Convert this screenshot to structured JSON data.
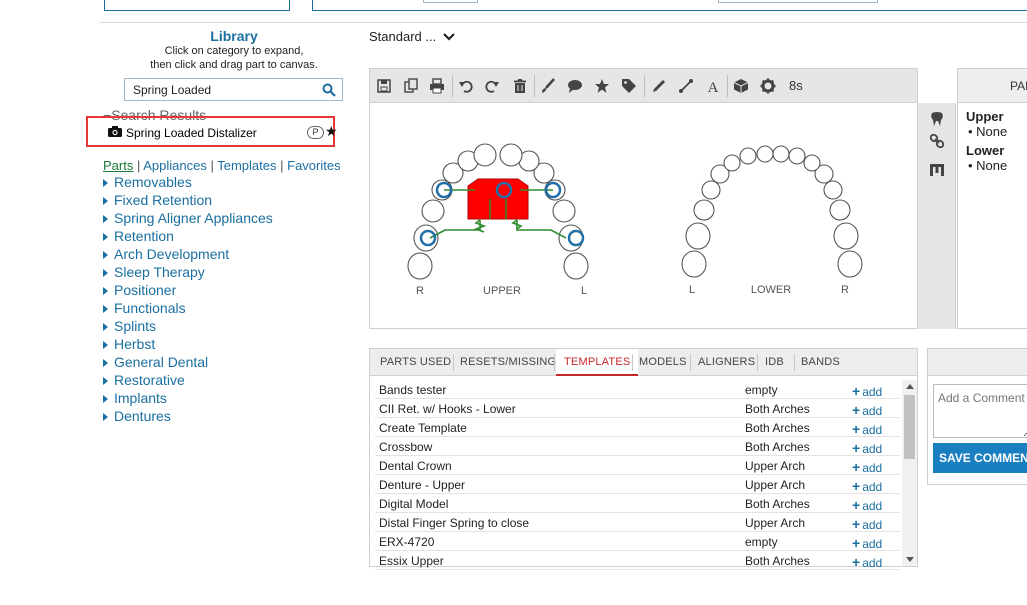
{
  "library": {
    "title": "Library",
    "hint1": "Click on category to expand,",
    "hint2": "then click and drag part to canvas.",
    "search_value": "Spring Loaded",
    "search_results_label": "Search Results",
    "result_item": "Spring Loaded Distalizer",
    "result_badge": "P",
    "tabs": [
      "Parts",
      "Appliances",
      "Templates",
      "Favorites"
    ],
    "categories": [
      "Removables",
      "Fixed Retention",
      "Spring Aligner Appliances",
      "Retention",
      "Arch Development",
      "Sleep Therapy",
      "Positioner",
      "Functionals",
      "Splints",
      "Herbst",
      "General Dental",
      "Restorative",
      "Implants",
      "Dentures"
    ]
  },
  "standard_dropdown": "Standard ...",
  "toolbar": {
    "timer": "8s",
    "icons": [
      "save-icon",
      "copy-icon",
      "print-icon",
      "undo-icon",
      "redo-icon",
      "trash-icon",
      "brush-icon",
      "comment-icon",
      "star-icon",
      "tag-icon",
      "pencil-icon",
      "line-icon",
      "text-icon",
      "cube-icon",
      "gear-icon"
    ]
  },
  "canvas": {
    "upper_label": "UPPER",
    "lower_label": "LOWER",
    "upper_left": "R",
    "upper_right": "L",
    "lower_left": "L",
    "lower_right": "R"
  },
  "parts_panel": {
    "header": "PARTS",
    "upper_label": "Upper",
    "upper_value": "None",
    "lower_label": "Lower",
    "lower_value": "None"
  },
  "tabs": [
    "Parts Used",
    "Resets/Missing",
    "Templates",
    "Models",
    "Aligners",
    "IDB",
    "Bands"
  ],
  "active_tab": "Templates",
  "templates": [
    {
      "name": "Bands tester",
      "arch": "empty",
      "action": "add"
    },
    {
      "name": "CII Ret. w/ Hooks - Lower",
      "arch": "Both Arches",
      "action": "add"
    },
    {
      "name": "Create Template",
      "arch": "Both Arches",
      "action": "add"
    },
    {
      "name": "Crossbow",
      "arch": "Both Arches",
      "action": "add"
    },
    {
      "name": "Dental Crown",
      "arch": "Upper Arch",
      "action": "add"
    },
    {
      "name": "Denture - Upper",
      "arch": "Upper Arch",
      "action": "add"
    },
    {
      "name": "Digital Model",
      "arch": "Both Arches",
      "action": "add"
    },
    {
      "name": "Distal Finger Spring to close",
      "arch": "Upper Arch",
      "action": "add"
    },
    {
      "name": "ERX-4720",
      "arch": "empty",
      "action": "add"
    },
    {
      "name": "Essix Upper",
      "arch": "Both Arches",
      "action": "add"
    }
  ],
  "comment": {
    "placeholder": "Add a Comment",
    "save_label": "SAVE COMMENT"
  },
  "colors": {
    "link": "#1a6fa0",
    "highlight_border": "#e53935",
    "active_tab": "#c62828",
    "appliance_red": "#ff0000",
    "wire_green": "#2e8b2e",
    "save_button": "#1a7fc1"
  }
}
